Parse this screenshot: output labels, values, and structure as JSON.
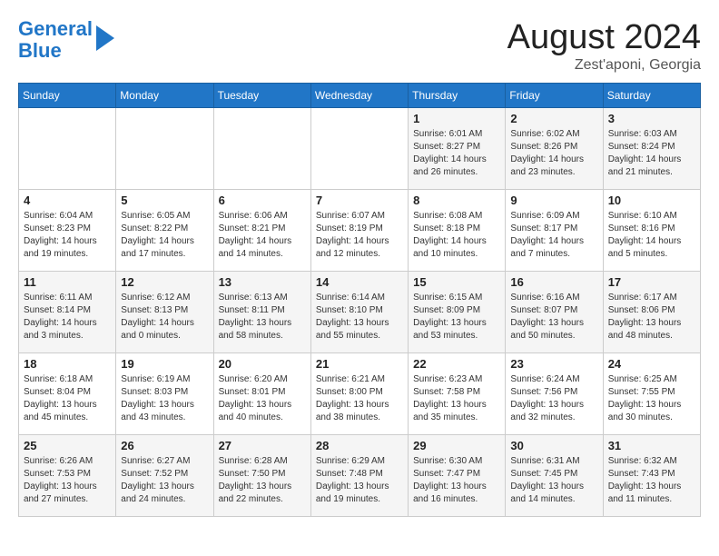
{
  "logo": {
    "line1": "General",
    "line2": "Blue"
  },
  "header": {
    "month": "August 2024",
    "location": "Zest'aponi, Georgia"
  },
  "weekdays": [
    "Sunday",
    "Monday",
    "Tuesday",
    "Wednesday",
    "Thursday",
    "Friday",
    "Saturday"
  ],
  "weeks": [
    [
      {
        "day": "",
        "info": ""
      },
      {
        "day": "",
        "info": ""
      },
      {
        "day": "",
        "info": ""
      },
      {
        "day": "",
        "info": ""
      },
      {
        "day": "1",
        "info": "Sunrise: 6:01 AM\nSunset: 8:27 PM\nDaylight: 14 hours\nand 26 minutes."
      },
      {
        "day": "2",
        "info": "Sunrise: 6:02 AM\nSunset: 8:26 PM\nDaylight: 14 hours\nand 23 minutes."
      },
      {
        "day": "3",
        "info": "Sunrise: 6:03 AM\nSunset: 8:24 PM\nDaylight: 14 hours\nand 21 minutes."
      }
    ],
    [
      {
        "day": "4",
        "info": "Sunrise: 6:04 AM\nSunset: 8:23 PM\nDaylight: 14 hours\nand 19 minutes."
      },
      {
        "day": "5",
        "info": "Sunrise: 6:05 AM\nSunset: 8:22 PM\nDaylight: 14 hours\nand 17 minutes."
      },
      {
        "day": "6",
        "info": "Sunrise: 6:06 AM\nSunset: 8:21 PM\nDaylight: 14 hours\nand 14 minutes."
      },
      {
        "day": "7",
        "info": "Sunrise: 6:07 AM\nSunset: 8:19 PM\nDaylight: 14 hours\nand 12 minutes."
      },
      {
        "day": "8",
        "info": "Sunrise: 6:08 AM\nSunset: 8:18 PM\nDaylight: 14 hours\nand 10 minutes."
      },
      {
        "day": "9",
        "info": "Sunrise: 6:09 AM\nSunset: 8:17 PM\nDaylight: 14 hours\nand 7 minutes."
      },
      {
        "day": "10",
        "info": "Sunrise: 6:10 AM\nSunset: 8:16 PM\nDaylight: 14 hours\nand 5 minutes."
      }
    ],
    [
      {
        "day": "11",
        "info": "Sunrise: 6:11 AM\nSunset: 8:14 PM\nDaylight: 14 hours\nand 3 minutes."
      },
      {
        "day": "12",
        "info": "Sunrise: 6:12 AM\nSunset: 8:13 PM\nDaylight: 14 hours\nand 0 minutes."
      },
      {
        "day": "13",
        "info": "Sunrise: 6:13 AM\nSunset: 8:11 PM\nDaylight: 13 hours\nand 58 minutes."
      },
      {
        "day": "14",
        "info": "Sunrise: 6:14 AM\nSunset: 8:10 PM\nDaylight: 13 hours\nand 55 minutes."
      },
      {
        "day": "15",
        "info": "Sunrise: 6:15 AM\nSunset: 8:09 PM\nDaylight: 13 hours\nand 53 minutes."
      },
      {
        "day": "16",
        "info": "Sunrise: 6:16 AM\nSunset: 8:07 PM\nDaylight: 13 hours\nand 50 minutes."
      },
      {
        "day": "17",
        "info": "Sunrise: 6:17 AM\nSunset: 8:06 PM\nDaylight: 13 hours\nand 48 minutes."
      }
    ],
    [
      {
        "day": "18",
        "info": "Sunrise: 6:18 AM\nSunset: 8:04 PM\nDaylight: 13 hours\nand 45 minutes."
      },
      {
        "day": "19",
        "info": "Sunrise: 6:19 AM\nSunset: 8:03 PM\nDaylight: 13 hours\nand 43 minutes."
      },
      {
        "day": "20",
        "info": "Sunrise: 6:20 AM\nSunset: 8:01 PM\nDaylight: 13 hours\nand 40 minutes."
      },
      {
        "day": "21",
        "info": "Sunrise: 6:21 AM\nSunset: 8:00 PM\nDaylight: 13 hours\nand 38 minutes."
      },
      {
        "day": "22",
        "info": "Sunrise: 6:23 AM\nSunset: 7:58 PM\nDaylight: 13 hours\nand 35 minutes."
      },
      {
        "day": "23",
        "info": "Sunrise: 6:24 AM\nSunset: 7:56 PM\nDaylight: 13 hours\nand 32 minutes."
      },
      {
        "day": "24",
        "info": "Sunrise: 6:25 AM\nSunset: 7:55 PM\nDaylight: 13 hours\nand 30 minutes."
      }
    ],
    [
      {
        "day": "25",
        "info": "Sunrise: 6:26 AM\nSunset: 7:53 PM\nDaylight: 13 hours\nand 27 minutes."
      },
      {
        "day": "26",
        "info": "Sunrise: 6:27 AM\nSunset: 7:52 PM\nDaylight: 13 hours\nand 24 minutes."
      },
      {
        "day": "27",
        "info": "Sunrise: 6:28 AM\nSunset: 7:50 PM\nDaylight: 13 hours\nand 22 minutes."
      },
      {
        "day": "28",
        "info": "Sunrise: 6:29 AM\nSunset: 7:48 PM\nDaylight: 13 hours\nand 19 minutes."
      },
      {
        "day": "29",
        "info": "Sunrise: 6:30 AM\nSunset: 7:47 PM\nDaylight: 13 hours\nand 16 minutes."
      },
      {
        "day": "30",
        "info": "Sunrise: 6:31 AM\nSunset: 7:45 PM\nDaylight: 13 hours\nand 14 minutes."
      },
      {
        "day": "31",
        "info": "Sunrise: 6:32 AM\nSunset: 7:43 PM\nDaylight: 13 hours\nand 11 minutes."
      }
    ]
  ]
}
